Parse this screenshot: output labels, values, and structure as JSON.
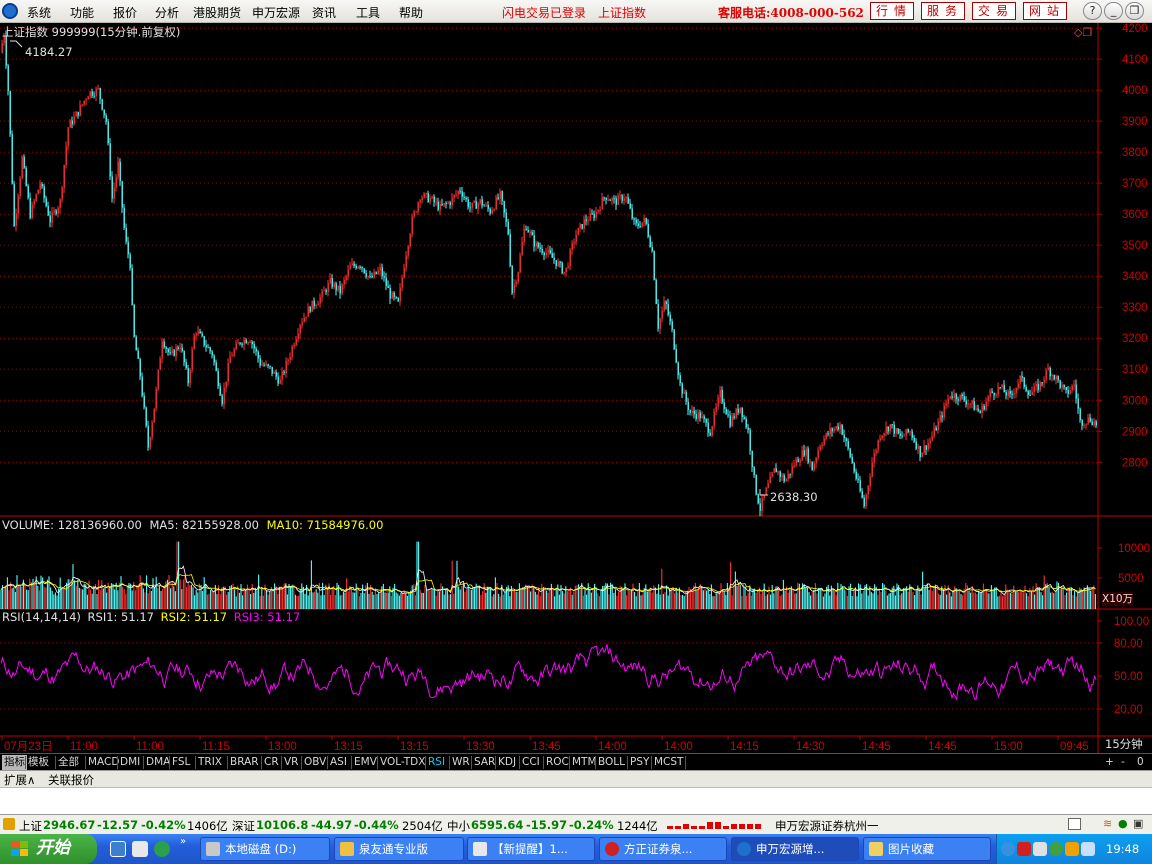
{
  "menu": {
    "items": [
      "系统",
      "功能",
      "报价",
      "分析",
      "港股期货",
      "申万宏源",
      "资讯",
      "工具",
      "帮助"
    ],
    "flash_status": "闪电交易已登录",
    "index_name": "上证指数",
    "hotline": "客服电话:4008-000-562",
    "service_buttons": [
      "行情",
      "服务",
      "交易",
      "网站"
    ],
    "window_buttons": [
      "?",
      "_",
      "❐",
      "✕"
    ]
  },
  "chart": {
    "header": "上证指数 999999(15分钟.前复权)",
    "price_high_label": "4184.27",
    "price_low_label": "2638.30",
    "price_axis": [
      "4200",
      "4100",
      "4000",
      "3900",
      "3800",
      "3700",
      "3600",
      "3500",
      "3400",
      "3300",
      "3200",
      "3100",
      "3000",
      "2900",
      "2800"
    ],
    "volume": {
      "label": "VOLUME:",
      "value": "128136960.00",
      "ma5_label": "MA5:",
      "ma5": "82155928.00",
      "ma10_label": "MA10:",
      "ma10": "71584976.00",
      "axis": [
        "10000",
        "5000"
      ],
      "unit": "X10万"
    },
    "rsi": {
      "label": "RSI(14,14,14)",
      "rsi1": "RSI1: 51.17",
      "rsi2": "RSI2: 51.17",
      "rsi3": "RSI3: 51.17",
      "axis": [
        "100.00",
        "80.00",
        "50.00",
        "20.00"
      ]
    },
    "time_axis": [
      "07月23日",
      "11:00",
      "11:00",
      "11:15",
      "13:00",
      "13:15",
      "13:15",
      "13:30",
      "13:45",
      "14:00",
      "14:00",
      "14:15",
      "14:30",
      "14:45",
      "14:45",
      "15:00",
      "09:45"
    ],
    "period": "15分钟",
    "colors": {
      "up": "#ff3232",
      "down": "#54ffff",
      "volume_ma5": "#ffffff",
      "volume_ma10": "#ffff00",
      "rsi": "#ff00ff",
      "grid": "#a00000",
      "axis": "#c00000"
    }
  },
  "indicator_tabs": [
    "指标",
    "模板",
    "全部",
    "MACD",
    "DMI",
    "DMA",
    "FSL",
    "TRIX",
    "BRAR",
    "CR",
    "VR",
    "OBV",
    "ASI",
    "EMV",
    "VOL-TDX",
    "RSI",
    "WR",
    "SAR",
    "KDJ",
    "CCI",
    "ROC",
    "MTM",
    "BOLL",
    "PSY",
    "MCST"
  ],
  "selected_tab": "RSI",
  "tab_controls": [
    "+",
    "-",
    "0"
  ],
  "ext_tabs": [
    "扩展∧",
    "关联报价"
  ],
  "index_bar": {
    "sh": {
      "name": "上证",
      "value": "2946.67",
      "change": "-12.57",
      "pct": "-0.42%",
      "amount": "1406亿"
    },
    "sz": {
      "name": "深证",
      "value": "10106.8",
      "change": "-44.97",
      "pct": "-0.44%",
      "amount": "2504亿"
    },
    "zx": {
      "name": "中小",
      "value": "6595.64",
      "change": "-15.97",
      "pct": "-0.24%",
      "amount": "1244亿"
    },
    "broker": "申万宏源证券杭州一"
  },
  "taskbar": {
    "start": "开始",
    "tasks": [
      "本地磁盘 (D:)",
      "泉友通专业版",
      "【新提醒】1...",
      "方正证券泉...",
      "申万宏源增...",
      "图片收藏"
    ],
    "clock": "19:48"
  }
}
